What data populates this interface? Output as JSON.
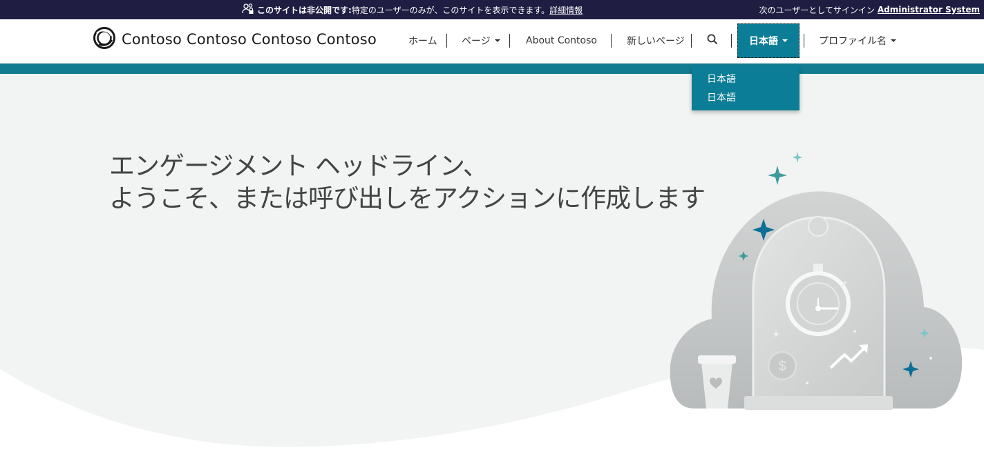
{
  "topbar": {
    "notice_bold": "このサイトは非公開です:",
    "notice_text": "特定のユーザーのみが、このサイトを表示できます。",
    "notice_link": "詳細情報",
    "signin_text": "次のユーザーとしてサインイン",
    "signin_user": "Administrator System"
  },
  "header": {
    "site_title": "Contoso Contoso Contoso Contoso"
  },
  "nav": {
    "home": "ホーム",
    "pages": "ページ",
    "about": "About Contoso",
    "new_page": "新しいページ",
    "language": "日本語",
    "profile": "プロファイル名"
  },
  "language_dropdown": {
    "options": [
      "日本語",
      "日本語"
    ]
  },
  "hero": {
    "headline_line1": "エンゲージメント ヘッドライン、",
    "headline_line2": "ようこそ、または呼び出しをアクションに作成します"
  },
  "colors": {
    "topbar": "#1f1d42",
    "accent": "#0b7d96",
    "stripe": "#137c90",
    "hero_bg": "#f2f4f3"
  },
  "icons": {
    "logo": "contoso-ring-logo",
    "private_notice": "users-lock-icon",
    "search": "search-icon"
  }
}
